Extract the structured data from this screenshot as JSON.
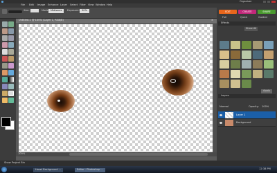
{
  "app": {
    "menu": [
      "File",
      "Edit",
      "Image",
      "Enhance",
      "Layer",
      "Select",
      "Filter",
      "View",
      "Window",
      "Help"
    ],
    "organizer_label": "Organizer"
  },
  "options_bar": {
    "size_label": "Size:",
    "mode_label": "Mode:",
    "mode_value": "Midtones",
    "exposure_label": "Exposure:",
    "exposure_value": "50%"
  },
  "document": {
    "tab_title": "Untitled-1 @ 100% (Layer 1, RGB/8)",
    "status": "100%"
  },
  "right_panel": {
    "mode_tabs": [
      "EDIT",
      "CREATE",
      "SHARE"
    ],
    "sub_tabs": [
      "Full",
      "Quick",
      "Guided"
    ],
    "effects_title": "Effects",
    "effects_dropdown": "Show All",
    "apply_label": "Apply",
    "layers_title": "Layers",
    "normal_label": "Normal",
    "opacity_label": "Opacity:",
    "opacity_value": "100%",
    "layers": [
      {
        "name": "Layer 1"
      },
      {
        "name": "Background"
      }
    ]
  },
  "project_bin_label": "Show Project Bin",
  "taskbar": {
    "items": [
      "Hazel Background ...",
      "Editor - Photoshop ..."
    ],
    "clock": "12:38 PM"
  },
  "colors": {
    "edit_tab": "#e8661c",
    "create_tab": "#c2287a",
    "share_tab": "#4a9a2f",
    "selected_layer": "#1b5fa8"
  }
}
